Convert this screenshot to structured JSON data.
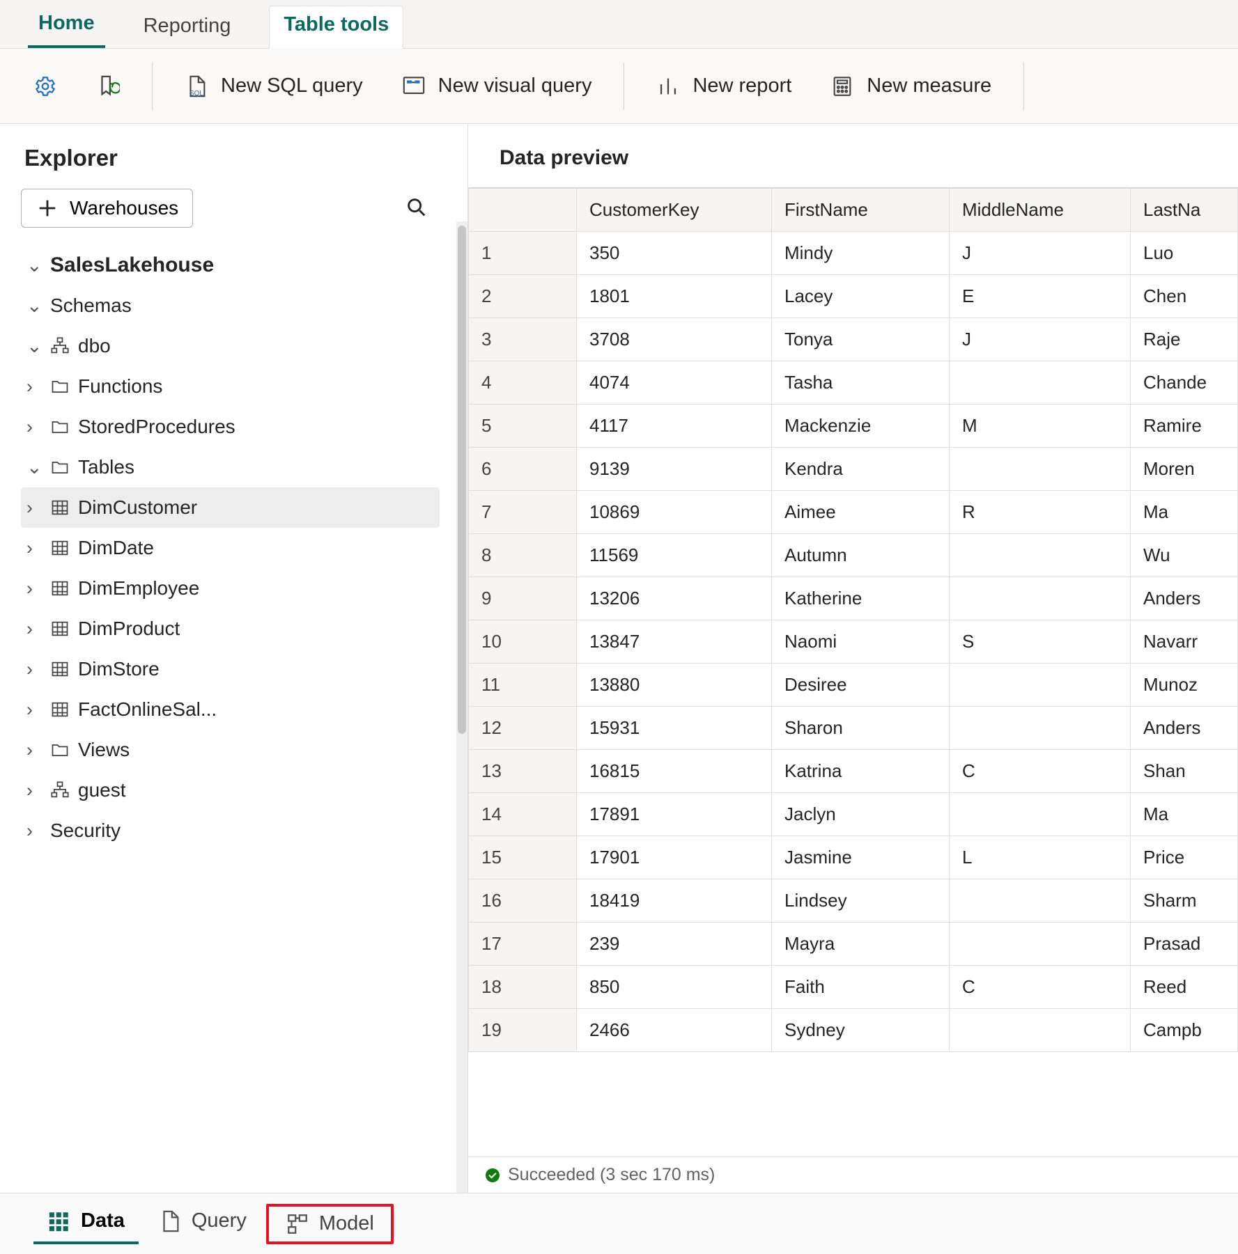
{
  "tabs": {
    "home": "Home",
    "reporting": "Reporting",
    "tabletools": "Table tools"
  },
  "ribbon": {
    "newsql": "New SQL query",
    "newvisual": "New visual query",
    "newreport": "New report",
    "newmeasure": "New measure"
  },
  "explorer": {
    "title": "Explorer",
    "warehouses_btn": "Warehouses",
    "tree": {
      "root": "SalesLakehouse",
      "schemas": "Schemas",
      "dbo": "dbo",
      "functions": "Functions",
      "sprocs": "StoredProcedures",
      "tables": "Tables",
      "table_list": [
        "DimCustomer",
        "DimDate",
        "DimEmployee",
        "DimProduct",
        "DimStore",
        "FactOnlineSal..."
      ],
      "views": "Views",
      "guest": "guest",
      "security": "Security"
    }
  },
  "preview": {
    "title": "Data preview",
    "columns": [
      "CustomerKey",
      "FirstName",
      "MiddleName",
      "LastNa"
    ],
    "rows": [
      [
        "350",
        "Mindy",
        "J",
        "Luo"
      ],
      [
        "1801",
        "Lacey",
        "E",
        "Chen"
      ],
      [
        "3708",
        "Tonya",
        "J",
        "Raje"
      ],
      [
        "4074",
        "Tasha",
        "",
        "Chande"
      ],
      [
        "4117",
        "Mackenzie",
        "M",
        "Ramire"
      ],
      [
        "9139",
        "Kendra",
        "",
        "Moren"
      ],
      [
        "10869",
        "Aimee",
        "R",
        "Ma"
      ],
      [
        "11569",
        "Autumn",
        "",
        "Wu"
      ],
      [
        "13206",
        "Katherine",
        "",
        "Anders"
      ],
      [
        "13847",
        "Naomi",
        "S",
        "Navarr"
      ],
      [
        "13880",
        "Desiree",
        "",
        "Munoz"
      ],
      [
        "15931",
        "Sharon",
        "",
        "Anders"
      ],
      [
        "16815",
        "Katrina",
        "C",
        "Shan"
      ],
      [
        "17891",
        "Jaclyn",
        "",
        "Ma"
      ],
      [
        "17901",
        "Jasmine",
        "L",
        "Price"
      ],
      [
        "18419",
        "Lindsey",
        "",
        "Sharm"
      ],
      [
        "239",
        "Mayra",
        "",
        "Prasad"
      ],
      [
        "850",
        "Faith",
        "C",
        "Reed"
      ],
      [
        "2466",
        "Sydney",
        "",
        "Campb"
      ]
    ],
    "status": "Succeeded (3 sec 170 ms)"
  },
  "footer": {
    "data": "Data",
    "query": "Query",
    "model": "Model"
  }
}
